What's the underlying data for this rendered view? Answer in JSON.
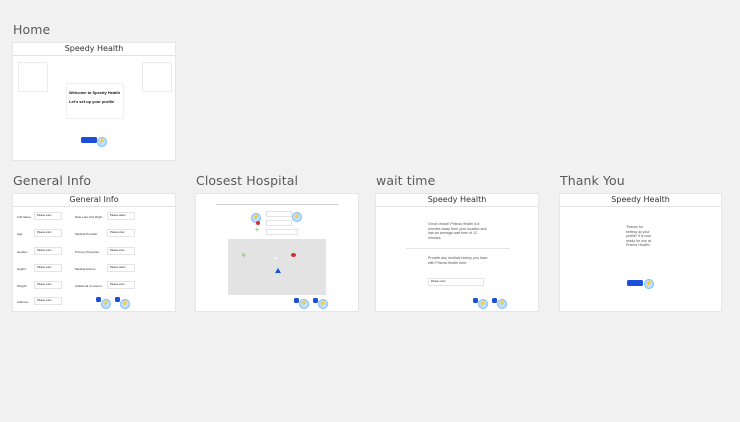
{
  "frames": {
    "home": {
      "label": "Home",
      "header": "Speedy Health",
      "welcome_line": "Welcome to Speedy Health",
      "setup_line": "Let's set up your profile"
    },
    "general_info": {
      "label": "General Info",
      "header": "General Info",
      "left_fields": [
        {
          "label": "Full Name:",
          "value": "Please enter"
        },
        {
          "label": "Age:",
          "value": "Please enter"
        },
        {
          "label": "Gender:",
          "value": "Please enter"
        },
        {
          "label": "Height:",
          "value": "Please enter"
        },
        {
          "label": "Weight:",
          "value": "Please enter"
        },
        {
          "label": "Address:",
          "value": "Please enter"
        }
      ],
      "right_fields": [
        {
          "label": "Date Last Visit Right:",
          "value": "Please select"
        },
        {
          "label": "Medical Provider:",
          "value": "Please enter"
        },
        {
          "label": "Primary Physician:",
          "value": "Please enter"
        },
        {
          "label": "Medical History:",
          "value": "Please select"
        },
        {
          "label": "Additional Concerns:",
          "value": "Please enter"
        }
      ]
    },
    "closest_hospital": {
      "label": "Closest Hospital"
    },
    "wait_time": {
      "label": "wait time",
      "header": "Speedy Health",
      "message": "Great choice! Prisma Health is 8 minutes away from your location and has an average wait time of 12 minutes.",
      "history_prompt": "Provide any medical history you have with Prisma Health here:",
      "history_value": "Please enter"
    },
    "thank_you": {
      "label": "Thank You",
      "header": "Speedy Health",
      "message": "Thanks for setting up your profile! It is now ready for use at Prisma Health!"
    }
  },
  "colors": {
    "background": "#f1f1f1",
    "primary_button": "#1c4fd8",
    "bolt_badge": "#bfe0ff",
    "map": "#e3e3e3",
    "marker_red": "#d32f2f",
    "marker_green": "#7ed957",
    "marker_blue": "#1c4fd8"
  },
  "icons": {
    "bolt": "⚡",
    "plus": "+"
  }
}
